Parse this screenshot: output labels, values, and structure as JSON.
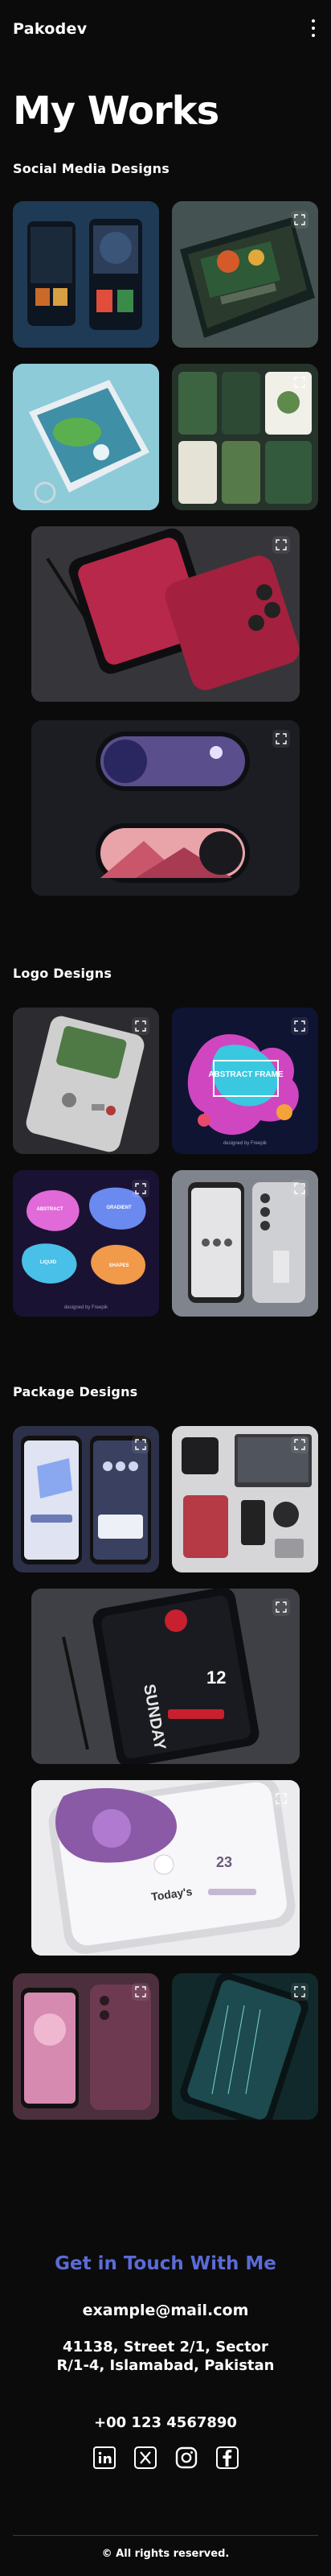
{
  "header": {
    "brand": "Pakodev",
    "menu_icon": "more-vertical-icon"
  },
  "page_title": "My Works",
  "sections": {
    "social": "Social Media Designs",
    "logo": "Logo Designs",
    "package": "Package Designs"
  },
  "cards": {
    "expand_icon": "expand-icon",
    "logo_card_2_title": "ABSTRACT FRAME",
    "logo_card_2_credit": "designed by Freepik",
    "logo_card_3_credit": "designed by Freepik",
    "logo_card_3_texts": [
      "ABSTRACT",
      "GRADIENT",
      "LIQUID",
      "SHAPES"
    ],
    "package_card_3_day": "SUNDAY",
    "package_card_3_date": "12",
    "package_card_4_day": "Today's",
    "package_card_4_number": "23"
  },
  "contact": {
    "title": "Get in Touch With Me",
    "email": "example@mail.com",
    "address": "41138, Street 2/1, Sector R/1-4, Islamabad, Pakistan",
    "phone": "+00 123 4567890"
  },
  "socials": [
    "linkedin-icon",
    "x-icon",
    "instagram-icon",
    "facebook-icon"
  ],
  "footer": {
    "copyright": "© All rights reserved."
  },
  "colors": {
    "background": "#0b0b0c",
    "accent": "#5a6bd6",
    "card_dark": "#1c1d22"
  }
}
